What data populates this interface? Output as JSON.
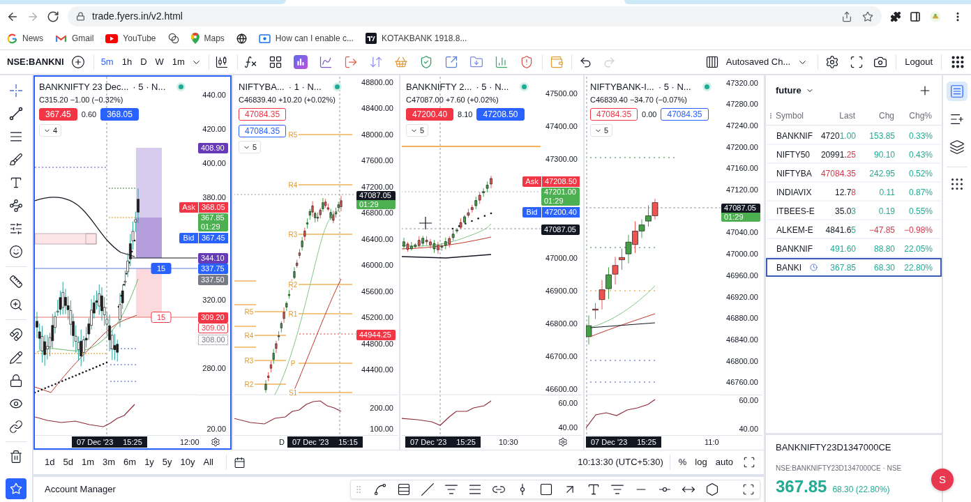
{
  "browser": {
    "nav": [
      {
        "kind": "back",
        "disabled": false
      },
      {
        "kind": "forward",
        "disabled": true
      },
      {
        "kind": "reload",
        "disabled": false
      }
    ],
    "url": "trade.fyers.in/v2.html",
    "bookmarks": [
      {
        "kind": "google",
        "label": "News"
      },
      {
        "kind": "gmail",
        "label": "Gmail"
      },
      {
        "kind": "youtube",
        "label": "YouTube"
      },
      {
        "kind": "link"
      },
      {
        "kind": "maps",
        "label": "Maps"
      },
      {
        "kind": "globe"
      },
      {
        "kind": "screen",
        "label": "How can I enable c..."
      },
      {
        "kind": "tv",
        "label": "KOTAKBANK 1918.8..."
      }
    ]
  },
  "toolbar": {
    "symbol": "NSE:BANKNI",
    "intervals": [
      {
        "label": "5m",
        "selected": true
      },
      {
        "label": "1h",
        "selected": false
      },
      {
        "label": "D",
        "selected": false
      },
      {
        "label": "W",
        "selected": false
      },
      {
        "label": "1m",
        "selected": false
      }
    ],
    "history": [
      {
        "kind": "undo",
        "disabled": false
      },
      {
        "kind": "redo",
        "disabled": true
      }
    ],
    "layout_name": "Autosaved Ch...",
    "logout": "Logout"
  },
  "charts": [
    {
      "selected": true,
      "symbol": "BANKNIFTY 23 Dec...",
      "meta": "· 5 · N...",
      "ohlc": "C315.20 −1.00 (−0.32%)",
      "quote": {
        "filled": true,
        "stacked": false,
        "sell": "367.45",
        "spread": "0.60",
        "buy": "368.05"
      },
      "indicators": "4",
      "price_ticks": [
        "440.00",
        "420.00",
        "400.00",
        "380.00",
        "320.00",
        "280.00"
      ],
      "pane_ticks": [
        "20.00"
      ],
      "badges": [
        {
          "kind": "price",
          "text": "408.90",
          "color": "#673ab7"
        },
        {
          "kind": "ask",
          "label": "Ask",
          "text": "368.05",
          "color": "#f23645"
        },
        {
          "kind": "last",
          "text": "367.85",
          "color": "#4caf50"
        },
        {
          "kind": "countdown",
          "text": "01:29",
          "color": "#4caf50"
        },
        {
          "kind": "bid",
          "label": "Bid",
          "text": "367.45",
          "color": "#2962ff"
        },
        {
          "kind": "price",
          "text": "344.10",
          "color": "#673ab7"
        },
        {
          "kind": "price",
          "text": "337.75",
          "color": "#2962ff"
        },
        {
          "kind": "price",
          "text": "337.50",
          "color": "#787b86"
        },
        {
          "kind": "price",
          "text": "309.20",
          "color": "#f23645"
        },
        {
          "kind": "outline",
          "text": "309.00",
          "color": "#f23645"
        },
        {
          "kind": "dotted",
          "text": "308.00",
          "color": "#787b86"
        }
      ],
      "plot_labels": [
        {
          "kind": "qty-filled",
          "text": "15"
        },
        {
          "kind": "qty-outline",
          "text": "15"
        }
      ],
      "cursor_date": "07 Dec '23",
      "cursor_time": "15:25",
      "time_labels": [
        "12:00"
      ],
      "gear": true
    },
    {
      "selected": false,
      "symbol": "NIFTYBA...",
      "meta": "· 1 · N...",
      "ohlc": "C46839.40 +10.20 (+0.02%)",
      "quote": {
        "filled": false,
        "stacked": true,
        "sell": "47084.35",
        "buy": "47084.35"
      },
      "indicators": "5",
      "price_ticks": [
        "48800.00",
        "48400.00",
        "48000.00",
        "47600.00",
        "47200.00",
        "46800.00",
        "46400.00",
        "46000.00",
        "45600.00",
        "45200.00",
        "44800.00",
        "44400.00"
      ],
      "pane_ticks": [
        "200.00",
        "100.00"
      ],
      "badges": [
        {
          "kind": "last",
          "text": "47087.05",
          "color": "#131722"
        },
        {
          "kind": "countdown",
          "text": "01:29",
          "color": "#4caf50"
        },
        {
          "kind": "price",
          "text": "44944.25",
          "color": "#f23645"
        }
      ],
      "plot_labels": [
        {
          "kind": "pivot",
          "text": "R5"
        },
        {
          "kind": "pivot",
          "text": "R4"
        },
        {
          "kind": "pivot",
          "text": "R3"
        },
        {
          "kind": "pivot",
          "text": "R2"
        },
        {
          "kind": "pivot",
          "text": "R5"
        },
        {
          "kind": "pivot",
          "text": "R1"
        },
        {
          "kind": "pivot",
          "text": "R4"
        },
        {
          "kind": "pivot",
          "text": "R3"
        },
        {
          "kind": "pivot",
          "text": "P"
        },
        {
          "kind": "pivot",
          "text": "R2"
        },
        {
          "kind": "pivot",
          "text": "S1"
        }
      ],
      "cursor_date": "07 Dec '23",
      "cursor_time": "15:15",
      "time_labels": [
        "D"
      ],
      "gear": false
    },
    {
      "selected": false,
      "symbol": "BANKNIFTY 2...",
      "meta": "· 5 · N...",
      "ohlc": "C47087.00 +7.60 (+0.02%)",
      "quote": {
        "filled": true,
        "stacked": false,
        "sell": "47200.40",
        "spread": "8.10",
        "buy": "47208.50"
      },
      "indicators": "5",
      "price_ticks": [
        "47500.00",
        "47400.00",
        "47300.00",
        "47000.00",
        "46900.00",
        "46800.00",
        "46700.00",
        "46600.00"
      ],
      "pane_ticks": [
        "60.00",
        "40.00"
      ],
      "badges": [
        {
          "kind": "ask",
          "label": "Ask",
          "text": "47208.50",
          "color": "#f23645"
        },
        {
          "kind": "last",
          "text": "47201.00",
          "color": "#4caf50"
        },
        {
          "kind": "countdown",
          "text": "01:29",
          "color": "#4caf50"
        },
        {
          "kind": "bid",
          "label": "Bid",
          "text": "47200.40",
          "color": "#2962ff"
        },
        {
          "kind": "price",
          "text": "47087.05",
          "color": "#131722"
        }
      ],
      "cursor_date": "07 Dec '23",
      "cursor_time": "15:25",
      "time_labels": [
        "10:30"
      ],
      "gear": true
    },
    {
      "selected": false,
      "symbol": "NIFTYBANK-I...",
      "meta": "· 5 · N...",
      "ohlc": "C46839.40 −34.70 (−0.07%)",
      "quote": {
        "filled": false,
        "stacked": false,
        "sell": "47084.35",
        "spread": "0.00",
        "buy": "47084.35"
      },
      "indicators": "5",
      "price_ticks": [
        "47320.00",
        "47280.00",
        "47240.00",
        "47200.00",
        "47160.00",
        "47120.00",
        "47040.00",
        "47000.00",
        "46960.00",
        "46920.00",
        "46880.00",
        "46840.00",
        "46800.00",
        "46760.00"
      ],
      "pane_ticks": [
        "60.00",
        "40.00"
      ],
      "badges": [
        {
          "kind": "last",
          "text": "47087.05",
          "color": "#131722"
        },
        {
          "kind": "countdown",
          "text": "01:29",
          "color": "#4caf50"
        }
      ],
      "cursor_date": "07 Dec '23",
      "cursor_time": "15:25",
      "time_labels": [
        "11:0"
      ],
      "gear": false
    }
  ],
  "range_bar": {
    "ranges": [
      "1d",
      "5d",
      "1m",
      "3m",
      "6m",
      "1y",
      "5y",
      "10y",
      "All"
    ],
    "clock": "10:13:30 (UTC+5:30)",
    "scale_options": [
      "%",
      "log",
      "auto"
    ]
  },
  "account_manager": {
    "title": "Account Manager"
  },
  "watchlist": {
    "title": "future",
    "columns": [
      "Symbol",
      "Last",
      "Chg",
      "Chg%"
    ],
    "rows": [
      {
        "symbol": "BANKNIF",
        "last": [
          {
            "text": "4720",
            "kind": "flat"
          },
          {
            "text": "1.00",
            "kind": "up"
          }
        ],
        "chg": "153.85",
        "chg_pct": "0.33%",
        "negative": false,
        "clock": false,
        "selected": false
      },
      {
        "symbol": "NIFTY50",
        "last": [
          {
            "text": "20991.",
            "kind": "flat"
          },
          {
            "text": "25",
            "kind": "down"
          }
        ],
        "chg": "90.10",
        "chg_pct": "0.43%",
        "negative": false,
        "clock": false,
        "selected": false
      },
      {
        "symbol": "NIFTYBA",
        "last": [
          {
            "text": "47084.35",
            "kind": "down"
          }
        ],
        "chg": "242.95",
        "chg_pct": "0.52%",
        "negative": false,
        "clock": false,
        "selected": false
      },
      {
        "symbol": "INDIAVIX",
        "last": [
          {
            "text": "12.7",
            "kind": "flat"
          },
          {
            "text": "8",
            "kind": "down"
          }
        ],
        "chg": "0.11",
        "chg_pct": "0.87%",
        "negative": false,
        "clock": false,
        "selected": false
      },
      {
        "symbol": "ITBEES-E",
        "last": [
          {
            "text": "35.0",
            "kind": "flat"
          },
          {
            "text": "3",
            "kind": "up"
          }
        ],
        "chg": "0.19",
        "chg_pct": "0.55%",
        "negative": false,
        "clock": false,
        "selected": false
      },
      {
        "symbol": "ALKEM-E",
        "last": [
          {
            "text": "4841.6",
            "kind": "flat"
          },
          {
            "text": "5",
            "kind": "up"
          }
        ],
        "chg": "−47.85",
        "chg_pct": "−0.98%",
        "negative": true,
        "clock": false,
        "selected": false
      },
      {
        "symbol": "BANKNIF",
        "last": [
          {
            "text": "491.60",
            "kind": "up"
          }
        ],
        "chg": "88.80",
        "chg_pct": "22.05%",
        "negative": false,
        "clock": false,
        "selected": false
      },
      {
        "symbol": "BANKI",
        "last": [
          {
            "text": "367.85",
            "kind": "up"
          }
        ],
        "chg": "68.30",
        "chg_pct": "22.80%",
        "negative": false,
        "clock": true,
        "selected": true
      }
    ]
  },
  "symbol_detail": {
    "symbol": "BANKNIFTY23D1347000CE",
    "exchange": "NSE:BANKNIFTY23D1347000CE · NSE",
    "price": "367.85",
    "change": "68.30 (22.80%)",
    "negative": false
  },
  "side_rail": [
    {
      "kind": "list",
      "selected": true
    },
    {
      "kind": "add-list",
      "selected": false
    },
    {
      "kind": "layers",
      "selected": false
    },
    {
      "kind": "dots",
      "selected": false
    }
  ],
  "avatar": {
    "initial": "S"
  }
}
